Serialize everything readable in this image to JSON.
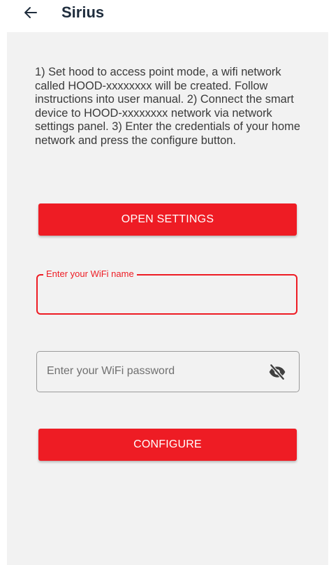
{
  "header": {
    "title": "Sirius",
    "back_icon": "arrow-left-icon"
  },
  "instructions": "1) Set hood to access point mode, a wifi network called HOOD-xxxxxxxx will be created. Follow instructions into user manual. 2) Connect the smart device to HOOD-xxxxxxxx network via network settings panel. 3) Enter the credentials of your home network and press the configure button.",
  "buttons": {
    "open_settings": "OPEN SETTINGS",
    "configure": "CONFIGURE"
  },
  "wifi_name": {
    "label": "Enter your WiFi name",
    "value": ""
  },
  "wifi_password": {
    "placeholder": "Enter your WiFi password",
    "value": "",
    "visibility_icon": "eye-off-icon"
  },
  "colors": {
    "accent": "#ee1c24",
    "background": "#f2f2f2",
    "title": "#1f2d3d"
  }
}
